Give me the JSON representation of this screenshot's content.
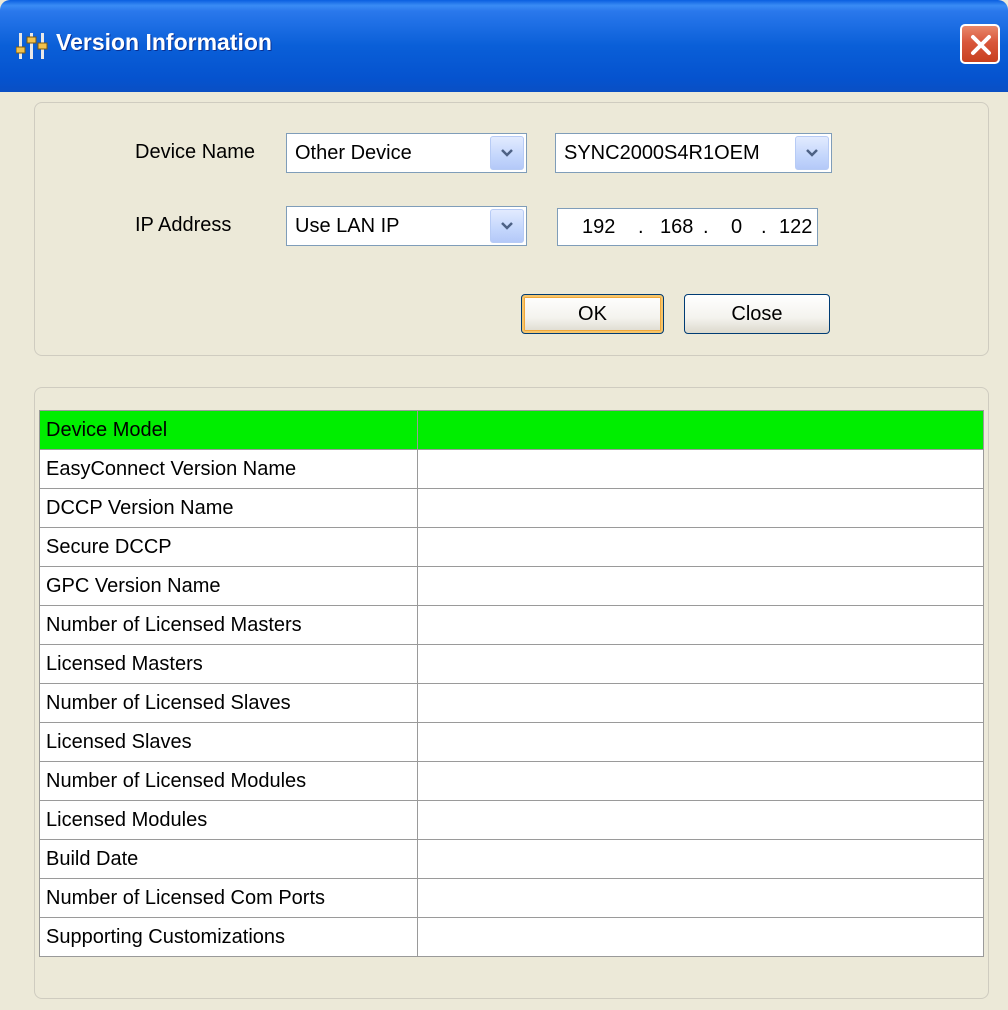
{
  "window": {
    "title": "Version Information",
    "icon": "sliders-icon"
  },
  "form": {
    "device_name_label": "Device Name",
    "device_type_value": "Other Device",
    "device_model_value": "SYNC2000S4R1OEM",
    "ip_address_label": "IP Address",
    "ip_mode_value": "Use LAN IP",
    "ip": [
      "192",
      "168",
      "0",
      "122"
    ],
    "ok_label": "OK",
    "close_label": "Close"
  },
  "table": {
    "header_color": "#00ee00",
    "rows": [
      {
        "key": "Device Model",
        "value": ""
      },
      {
        "key": "EasyConnect Version Name",
        "value": ""
      },
      {
        "key": "DCCP Version Name",
        "value": ""
      },
      {
        "key": "Secure DCCP",
        "value": ""
      },
      {
        "key": "GPC Version Name",
        "value": ""
      },
      {
        "key": "Number of Licensed Masters",
        "value": ""
      },
      {
        "key": "Licensed Masters",
        "value": ""
      },
      {
        "key": "Number of Licensed Slaves",
        "value": ""
      },
      {
        "key": "Licensed Slaves",
        "value": ""
      },
      {
        "key": "Number of Licensed Modules",
        "value": ""
      },
      {
        "key": "Licensed Modules",
        "value": ""
      },
      {
        "key": "Build Date",
        "value": ""
      },
      {
        "key": "Number of Licensed Com Ports",
        "value": ""
      },
      {
        "key": "Supporting Customizations",
        "value": ""
      }
    ]
  }
}
